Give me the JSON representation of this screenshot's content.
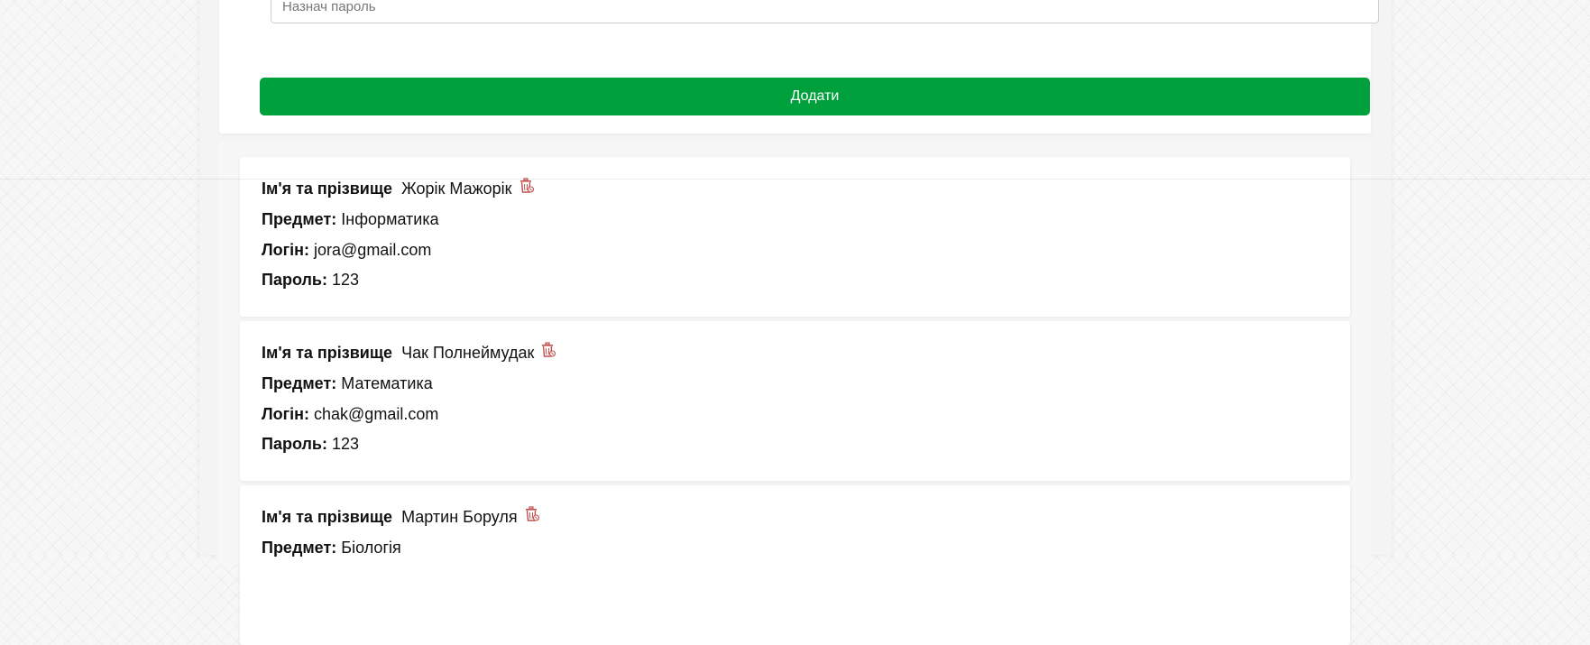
{
  "form": {
    "password_placeholder": "Назнач пароль",
    "add_button_label": "Додати"
  },
  "labels": {
    "name": "Ім'я та прізвище",
    "subject": "Предмет:",
    "login": "Логін:",
    "password": "Пароль:"
  },
  "teachers": [
    {
      "name": "Жорік Мажорік",
      "subject": "Інформатика",
      "login": "jora@gmail.com",
      "password": "123"
    },
    {
      "name": "Чак Полнеймудак",
      "subject": "Математика",
      "login": "chak@gmail.com",
      "password": "123"
    },
    {
      "name": "Мартин Боруля",
      "subject": "Біологія"
    }
  ],
  "icons": {
    "delete": "trash-icon"
  },
  "colors": {
    "accent": "#00a03d",
    "delete_icon": "#c0504d"
  }
}
